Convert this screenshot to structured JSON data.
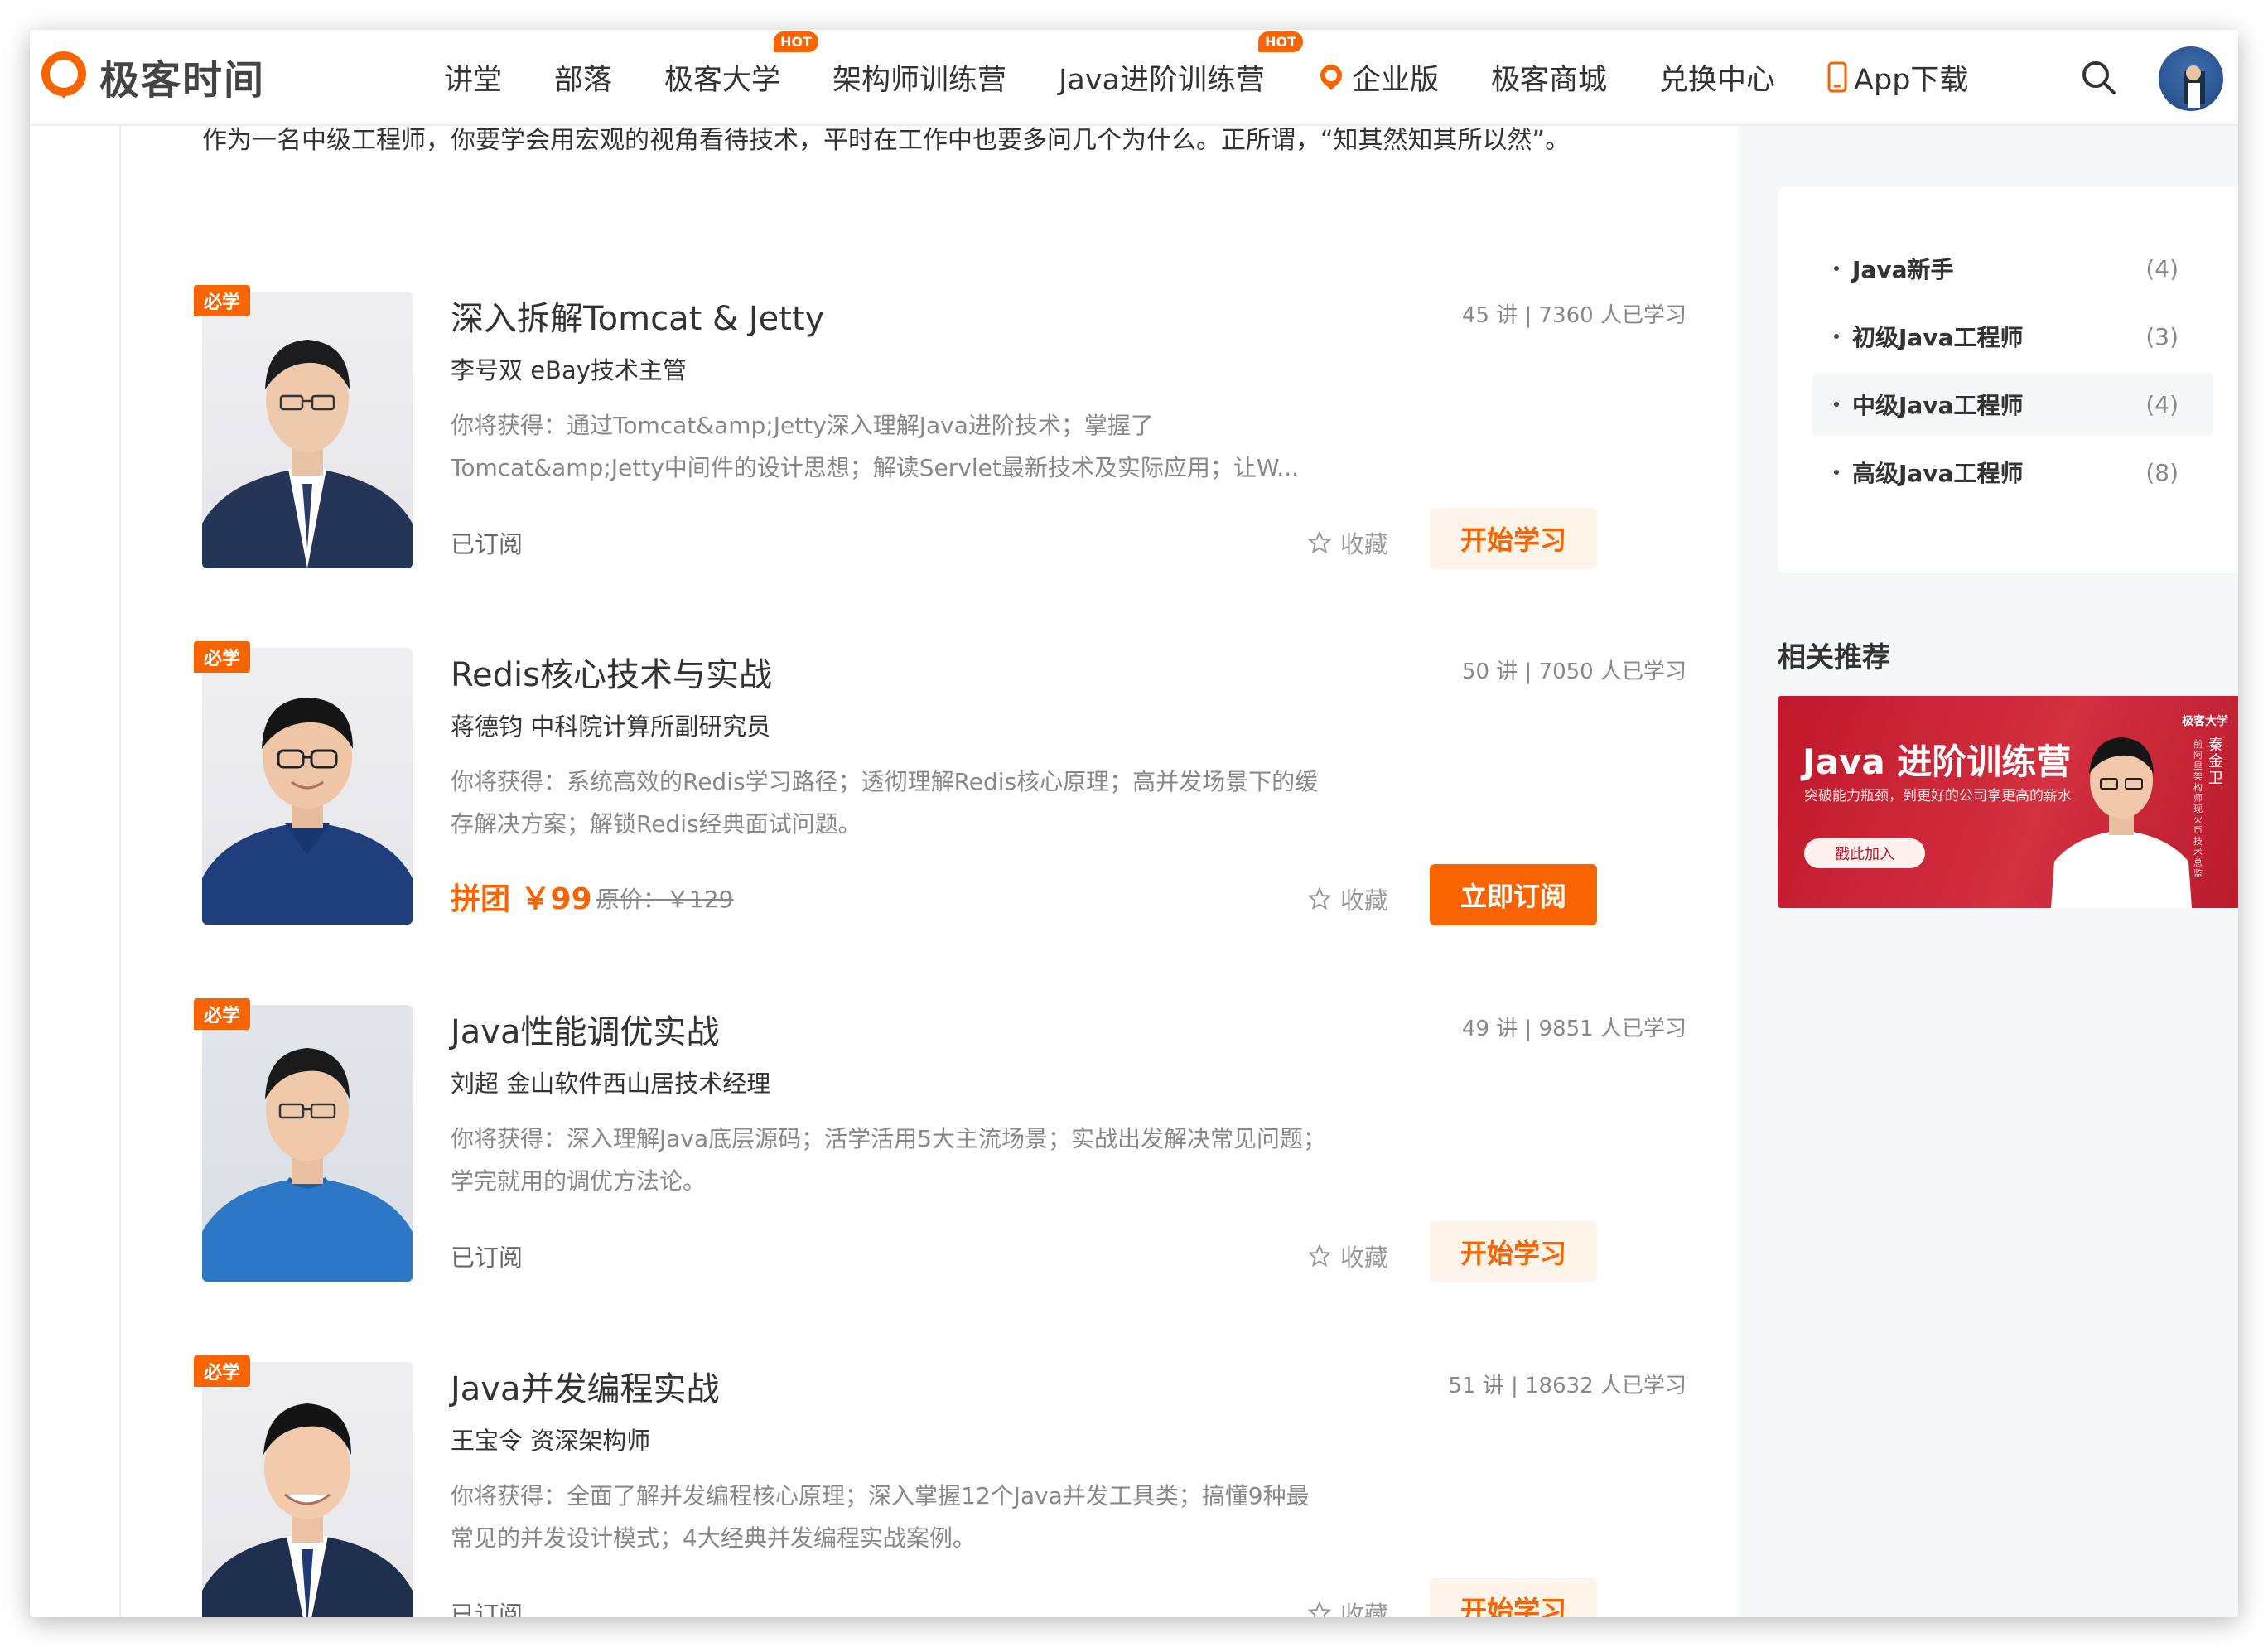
{
  "header": {
    "logo_text": "极客时间",
    "nav": [
      {
        "label": "讲堂",
        "hot": ""
      },
      {
        "label": "部落",
        "hot": ""
      },
      {
        "label": "极客大学",
        "hot": "HOT"
      },
      {
        "label": "架构师训练营",
        "hot": ""
      },
      {
        "label": "Java进阶训练营",
        "hot": "HOT"
      },
      {
        "label": "企业版",
        "hot": ""
      },
      {
        "label": "极客商城",
        "hot": ""
      },
      {
        "label": "兑换中心",
        "hot": ""
      },
      {
        "label": "App下载",
        "hot": ""
      }
    ],
    "search_icon": "search-icon",
    "avatar_icon": "user-avatar"
  },
  "intro": "作为一名中级工程师，你要学会用宏观的视角看待技术，平时在工作中也要多问几个为什么。正所谓，“知其然知其所以然”。",
  "courses": [
    {
      "badge": "必学",
      "title": "深入拆解Tomcat & Jetty",
      "meta": "45 讲 | 7360 人已学习",
      "author": "李号双 eBay技术主管",
      "desc": "你将获得：通过Tomcat&amp;Jetty深入理解Java进阶技术；掌握了Tomcat&amp;Jetty中间件的设计思想；解读Servlet最新技术及实际应用；让W...",
      "status": "已订阅",
      "price": "",
      "orig_price": "",
      "fav": "收藏",
      "button": "开始学习",
      "button_style": "light"
    },
    {
      "badge": "必学",
      "title": "Redis核心技术与实战",
      "meta": "50 讲 | 7050 人已学习",
      "author": "蒋德钧 中科院计算所副研究员",
      "desc": "你将获得：系统高效的Redis学习路径；透彻理解Redis核心原理；高并发场景下的缓存解决方案；解锁Redis经典面试问题。",
      "status": "",
      "price": "拼团 ￥99",
      "orig_price": "原价：￥129",
      "fav": "收藏",
      "button": "立即订阅",
      "button_style": "solid"
    },
    {
      "badge": "必学",
      "title": "Java性能调优实战",
      "meta": "49 讲 | 9851 人已学习",
      "author": "刘超 金山软件西山居技术经理",
      "desc": "你将获得：深入理解Java底层源码；活学活用5大主流场景；实战出发解决常见问题；学完就用的调优方法论。",
      "status": "已订阅",
      "price": "",
      "orig_price": "",
      "fav": "收藏",
      "button": "开始学习",
      "button_style": "light"
    },
    {
      "badge": "必学",
      "title": "Java并发编程实战",
      "meta": "51 讲 | 18632 人已学习",
      "author": "王宝令 资深架构师",
      "desc": "你将获得：全面了解并发编程核心原理；深入掌握12个Java并发工具类；搞懂9种最常见的并发设计模式；4大经典并发编程实战案例。",
      "status": "已订阅",
      "price": "",
      "orig_price": "",
      "fav": "收藏",
      "button": "开始学习",
      "button_style": "light"
    }
  ],
  "sidebar": {
    "categories": [
      {
        "label": "Java新手",
        "count": "(4)",
        "active": false
      },
      {
        "label": "初级Java工程师",
        "count": "(3)",
        "active": false
      },
      {
        "label": "中级Java工程师",
        "count": "(4)",
        "active": true
      },
      {
        "label": "高级Java工程师",
        "count": "(8)",
        "active": false
      }
    ],
    "related_title": "相关推荐",
    "banner": {
      "title": "Java 进阶训练营",
      "subtitle": "突破能力瓶颈，到更好的公司拿更高的薪水",
      "button": "戳此加入",
      "brand": "极客大学",
      "teacher": "秦金卫",
      "teacher_role": "前阿里架构师 现火币技术总监"
    }
  },
  "colors": {
    "accent": "#fa6400",
    "accent_light": "#fff4ea",
    "banner_red": "#c0182c",
    "sidebar_bg": "#f6f7f9"
  }
}
